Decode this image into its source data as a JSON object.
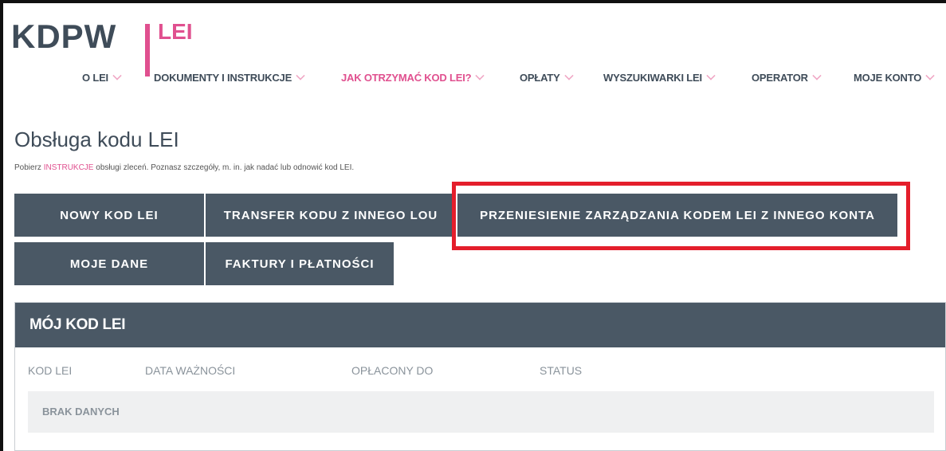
{
  "logo": {
    "brand": "KDPW",
    "product": "LEI"
  },
  "nav": {
    "items": [
      {
        "label": "O LEI"
      },
      {
        "label": "DOKUMENTY I INSTRUKCJE"
      },
      {
        "label": "JAK OTRZYMAĆ KOD LEI?"
      },
      {
        "label": "OPŁATY"
      },
      {
        "label": "WYSZUKIWARKI LEI"
      },
      {
        "label": "OPERATOR"
      },
      {
        "label": "MOJE KONTO"
      }
    ],
    "active_index": 2,
    "active_color": "#e0508f"
  },
  "page": {
    "title": "Obsługa kodu LEI",
    "subtitle_pre": "Pobierz ",
    "subtitle_link": "INSTRUKCJE",
    "subtitle_post": " obsługi zleceń. Poznasz szczegóły, m. in. jak nadać lub odnowić kod LEI."
  },
  "actions": {
    "new_code": "NOWY KOD LEI",
    "transfer": "TRANSFER KODU Z INNEGO LOU",
    "move_management": "PRZENIESIENIE ZARZĄDZANIA KODEM LEI Z INNEGO KONTA",
    "my_data": "MOJE DANE",
    "invoices": "FAKTURY I PŁATNOŚCI"
  },
  "panel": {
    "title": "MÓJ KOD LEI",
    "columns": [
      "KOD LEI",
      "DATA WAŻNOŚCI",
      "OPŁACONY DO",
      "STATUS"
    ],
    "empty_text": "BRAK DANYCH"
  },
  "colors": {
    "brand_dark": "#3f4c59",
    "button_bg": "#4a5865",
    "accent_pink": "#e0508f",
    "highlight_red": "#e41e2b"
  }
}
